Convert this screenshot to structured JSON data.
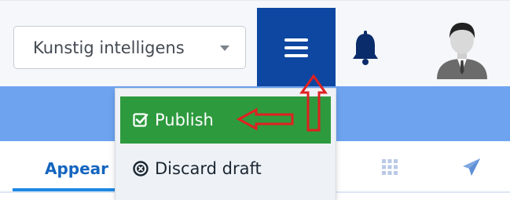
{
  "header": {
    "workspace_select_value": "Kunstig intelligens",
    "menu_icon": "hamburger-menu-icon",
    "notification_icon": "bell-icon",
    "avatar_icon": "user-avatar-icon"
  },
  "tabs": {
    "active_label": "Appear",
    "grid_icon": "grid-icon",
    "send_icon": "paper-plane-icon"
  },
  "dropdown": {
    "items": [
      {
        "label": "Publish",
        "icon": "checkbox-checked-icon"
      },
      {
        "label": "Discard draft",
        "icon": "circle-x-icon"
      }
    ]
  },
  "colors": {
    "menu_button": "#0d47a1",
    "publish_bg": "#2e9a3e",
    "blue_band": "#6ea3f0",
    "tab_active": "#1565c0",
    "annotation_arrow": "#e02020"
  }
}
